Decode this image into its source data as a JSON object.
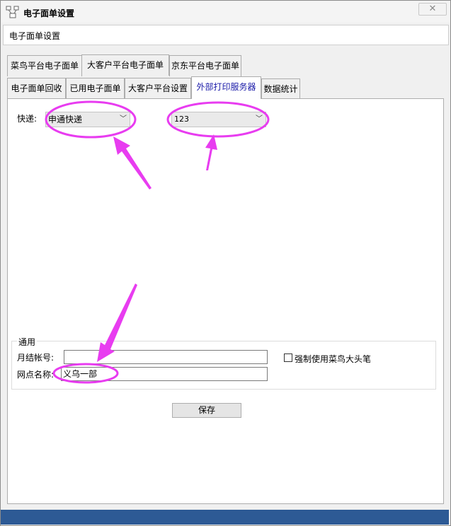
{
  "window": {
    "title": "电子面单设置",
    "close_glyph": "✕"
  },
  "header": {
    "text": "电子面单设置"
  },
  "tabs_row1": [
    {
      "label": "菜鸟平台电子面单"
    },
    {
      "label": "大客户平台电子面单"
    },
    {
      "label": "京东平台电子面单"
    }
  ],
  "tabs_row2": [
    {
      "label": "电子面单回收"
    },
    {
      "label": "已用电子面单"
    },
    {
      "label": "大客户平台设置"
    },
    {
      "label": "外部打印服务器"
    },
    {
      "label": "数据统计"
    }
  ],
  "form": {
    "express_label": "快递:",
    "express_value": "申通快递",
    "printer_value": "123",
    "group_title": "通用",
    "account_label": "月结帐号:",
    "account_value": "",
    "site_label": "网点名称:",
    "site_value": "义乌一部",
    "checkbox_label": "强制使用菜鸟大头笔",
    "checkbox_checked": false,
    "save_label": "保存"
  },
  "icons": {
    "app": "app-network-icon",
    "dropdown": "chevron-down-icon"
  },
  "colors": {
    "annotation": "#e83cf0",
    "statusbar": "#2d5a95",
    "active_tab_text": "#1a1aa8"
  }
}
